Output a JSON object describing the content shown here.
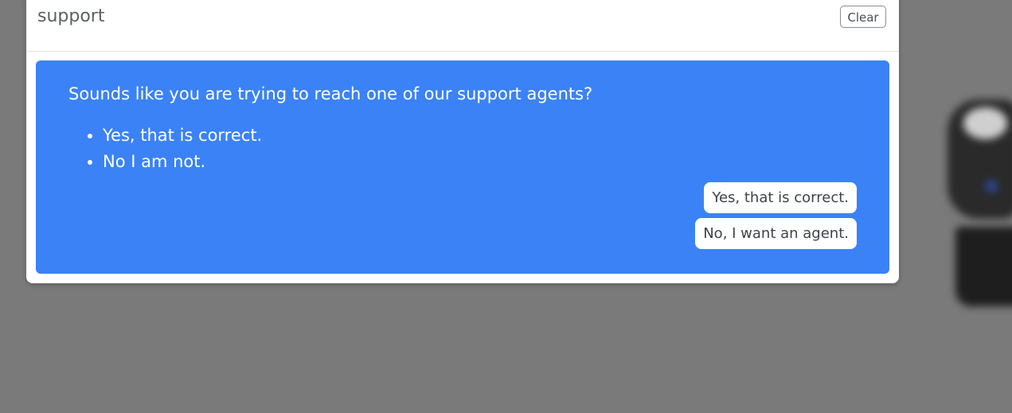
{
  "panel": {
    "title": "support",
    "clear_label": "Clear"
  },
  "message": {
    "question": "Sounds like you are trying to reach one of our support agents?",
    "options": [
      "Yes, that is correct.",
      "No I am not."
    ],
    "quick_replies": [
      "Yes, that is correct.",
      "No, I want an agent."
    ]
  },
  "colors": {
    "backdrop": "#7a7a7a",
    "message_bg": "#3b82f6",
    "panel_bg": "#ffffff"
  }
}
